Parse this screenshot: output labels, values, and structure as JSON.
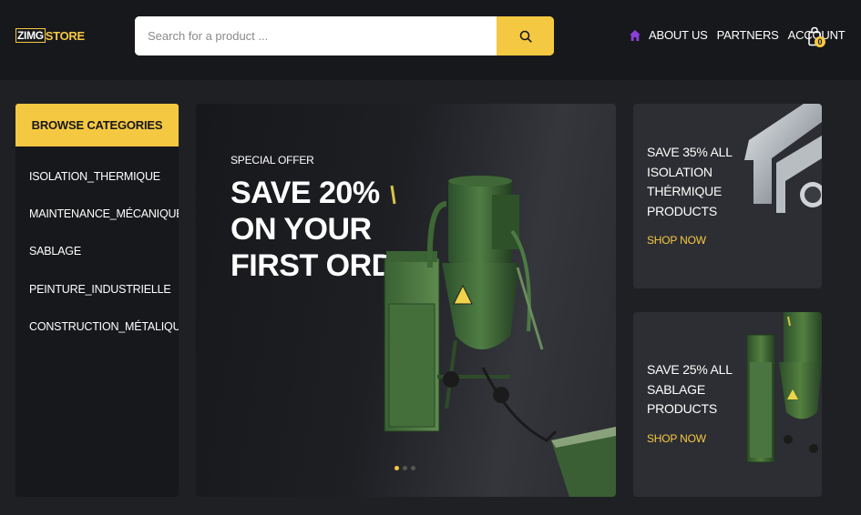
{
  "brand": {
    "logo_zimg": "ZIMG",
    "logo_store": "STORE"
  },
  "search": {
    "placeholder": "Search for a product ..."
  },
  "nav": {
    "items": [
      "ABOUT US",
      "PARTNERS",
      "ACCOUNT"
    ],
    "cart_count": "0"
  },
  "sidebar": {
    "header": "BROWSE CATEGORIES",
    "items": [
      "ISOLATION_THERMIQUE",
      "MAINTENANCE_MÉCANIQUE",
      "SABLAGE",
      "PEINTURE_INDUSTRIELLE",
      "CONSTRUCTION_MÉTALIQUE"
    ]
  },
  "hero": {
    "eyebrow": "SPECIAL OFFER",
    "headline": [
      "SAVE 20%",
      "ON YOUR",
      "FIRST ORDER"
    ],
    "slides": 3,
    "active_slide": 1
  },
  "promos": [
    {
      "title": "SAVE 35% ALL ISOLATION THÉRMIQUE PRODUCTS",
      "cta": "SHOP NOW"
    },
    {
      "title": "SAVE 25% ALL SABLAGE PRODUCTS",
      "cta": "SHOP NOW"
    }
  ],
  "colors": {
    "accent": "#f5c842",
    "home_icon": "#8b3fd9",
    "background": "#1f2024",
    "topbar": "#17181b"
  }
}
